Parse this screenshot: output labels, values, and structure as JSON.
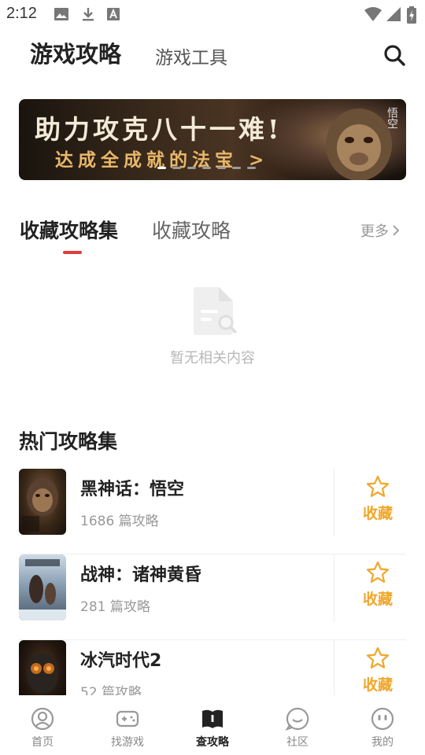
{
  "status_bar": {
    "time": "2:12",
    "left_icons": [
      "image-icon",
      "download-icon",
      "font-icon"
    ],
    "right_icons": [
      "wifi-icon",
      "signal-icon",
      "battery-icon"
    ]
  },
  "header": {
    "tabs": [
      {
        "label": "游戏攻略",
        "active": true
      },
      {
        "label": "游戏工具",
        "active": false
      }
    ],
    "search_icon": "search-icon"
  },
  "banner": {
    "line1": "助力攻克八十一难!",
    "line2": "达成全成就的法宝 >",
    "badge": "悟空",
    "dot_count": 7,
    "active_dot": 0
  },
  "collections": {
    "tabs": [
      {
        "label": "收藏攻略集",
        "active": true
      },
      {
        "label": "收藏攻略",
        "active": false
      }
    ],
    "more_label": "更多",
    "empty_text": "暂无相关内容",
    "accent_color": "#e23b3b"
  },
  "hot": {
    "title": "热门攻略集",
    "items": [
      {
        "name": "黑神话：悟空",
        "count": "1686 篇攻略",
        "fav_label": "收藏"
      },
      {
        "name": "战神：诸神黄昏",
        "count": "281 篇攻略",
        "fav_label": "收藏"
      },
      {
        "name": "冰汽时代2",
        "count": "52 篇攻略",
        "fav_label": "收藏"
      }
    ],
    "fav_color": "#f0a72a"
  },
  "bottom_nav": {
    "items": [
      {
        "label": "首页",
        "icon": "home-icon",
        "active": false
      },
      {
        "label": "找游戏",
        "icon": "gamepad-icon",
        "active": false
      },
      {
        "label": "查攻略",
        "icon": "book-icon",
        "active": true
      },
      {
        "label": "社区",
        "icon": "chat-icon",
        "active": false
      },
      {
        "label": "我的",
        "icon": "profile-icon",
        "active": false
      }
    ]
  }
}
